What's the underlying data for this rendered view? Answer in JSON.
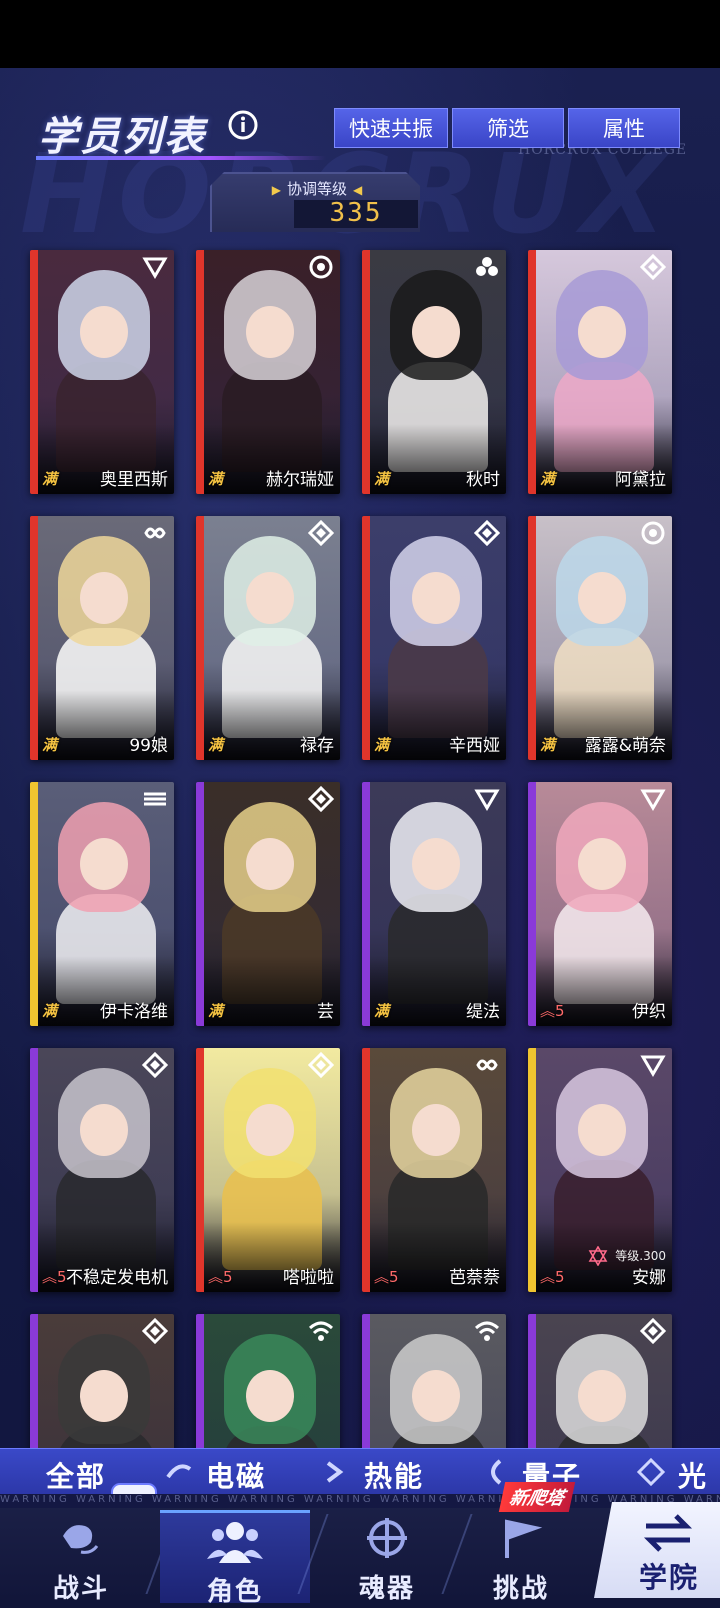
{
  "header": {
    "title": "学员列表",
    "tabs": [
      "快速共振",
      "筛选",
      "属性"
    ],
    "college_watermark": "HORCRUX COLLEGE",
    "bg_watermark": "HORCRUX"
  },
  "sync": {
    "label": "协调等级",
    "value": "335"
  },
  "cards": [
    {
      "name": "奥里西斯",
      "level": "满",
      "stripe": "#e0352b",
      "hair": "#cfd6ea",
      "body": "#3a2330",
      "bg": "#4a2a3e",
      "badge": "tri-icon"
    },
    {
      "name": "赫尔瑞娅",
      "level": "满",
      "stripe": "#e0352b",
      "hair": "#d8d2d8",
      "body": "#2a1c24",
      "bg": "#3a2028",
      "badge": "swirl-icon"
    },
    {
      "name": "秋时",
      "level": "满",
      "stripe": "#e0352b",
      "hair": "#1a1a1a",
      "body": "#e8e6e4",
      "bg": "#3a3a42",
      "badge": "clover-icon"
    },
    {
      "name": "阿黛拉",
      "level": "满",
      "stripe": "#e0352b",
      "hair": "#a79ad6",
      "body": "#eaa8c8",
      "bg": "#d6c8dc",
      "badge": "diamond-icon"
    },
    {
      "name": "99娘",
      "level": "满",
      "stripe": "#e0352b",
      "hair": "#efd79a",
      "body": "#f4f4f4",
      "bg": "#6a6a78",
      "badge": "infinity-icon"
    },
    {
      "name": "禄存",
      "level": "满",
      "stripe": "#e0352b",
      "hair": "#dff0e6",
      "body": "#f2f2f2",
      "bg": "#7b8090",
      "badge": "diamond-icon"
    },
    {
      "name": "辛西娅",
      "level": "满",
      "stripe": "#e0352b",
      "hair": "#d5d3ec",
      "body": "#4a3a48",
      "bg": "#3c3e6a",
      "badge": "diamond-icon"
    },
    {
      "name": "露露&萌奈",
      "level": "满",
      "stripe": "#e0352b",
      "hair": "#bcd8ea",
      "body": "#ecdcc2",
      "bg": "#c8c0c8",
      "badge": "swirl-icon"
    },
    {
      "name": "伊卡洛维",
      "level": "满",
      "stripe": "#f0c530",
      "hair": "#f0a0b0",
      "body": "#e8e8ec",
      "bg": "#5a5e78",
      "badge": "wave-icon"
    },
    {
      "name": "芸",
      "level": "满",
      "stripe": "#8a3ad8",
      "hair": "#e6d08a",
      "body": "#4a3828",
      "bg": "#3a2e28",
      "badge": "diamond-icon"
    },
    {
      "name": "缇法",
      "level": "满",
      "stripe": "#8a3ad8",
      "hair": "#eeeef4",
      "body": "#2a2a2e",
      "bg": "#3c3a58",
      "badge": "tri-icon"
    },
    {
      "name": "伊织",
      "level": "5",
      "stripe": "#8a3ad8",
      "hair": "#f0a8bc",
      "body": "#f2e6ea",
      "bg": "#b88a98",
      "badge": "tri-icon"
    },
    {
      "name": "不稳定发电机",
      "level": "5",
      "stripe": "#8a3ad8",
      "hair": "#c8c4cc",
      "body": "#2a2a30",
      "bg": "#4a4658",
      "badge": "diamond-icon"
    },
    {
      "name": "嗒啦啦",
      "level": "5",
      "stripe": "#e0352b",
      "hair": "#f2e070",
      "body": "#e8c050",
      "bg": "#f2eaa0",
      "badge": "diamond-icon"
    },
    {
      "name": "芭萘萘",
      "level": "5",
      "stripe": "#e0352b",
      "hair": "#e6d6a0",
      "body": "#2a2a2a",
      "bg": "#5a4a3a",
      "badge": "infinity-icon"
    },
    {
      "name": "安娜",
      "level": "5",
      "stripe": "#f0c530",
      "hair": "#d8c8e0",
      "body": "#3a2030",
      "bg": "#5a4868",
      "badge": "tri-icon",
      "level_text": "等级.300"
    },
    {
      "name": "",
      "level": "",
      "stripe": "#8a3ad8",
      "hair": "#3a3a3a",
      "body": "#2a2a2e",
      "bg": "#4a3c3a",
      "badge": "diamond-icon"
    },
    {
      "name": "",
      "level": "",
      "stripe": "#8a3ad8",
      "hair": "#3a8a5a",
      "body": "#2a2a2e",
      "bg": "#2a4a3a",
      "badge": "wifi-icon"
    },
    {
      "name": "",
      "level": "",
      "stripe": "#8a3ad8",
      "hair": "#cccccc",
      "body": "#2a2a2e",
      "bg": "#5a5a60",
      "badge": "wifi-icon"
    },
    {
      "name": "",
      "level": "",
      "stripe": "#8a3ad8",
      "hair": "#dddddd",
      "body": "#2a2a2e",
      "bg": "#4a4450",
      "badge": "diamond-icon"
    }
  ],
  "filters": [
    "全部",
    "电磁",
    "热能",
    "量子",
    "光"
  ],
  "nav": {
    "warning": "WARNING WARNING WARNING WARNING WARNING WARNING WARNING WARNING WARNING WARNING WARNING",
    "items": [
      "战斗",
      "角色",
      "魂器",
      "挑战"
    ],
    "academy": "学院",
    "new_tag": "新爬塔"
  },
  "colors": {
    "accent": "#4a58e0",
    "gold": "#f0c04a",
    "background": "#121740"
  }
}
